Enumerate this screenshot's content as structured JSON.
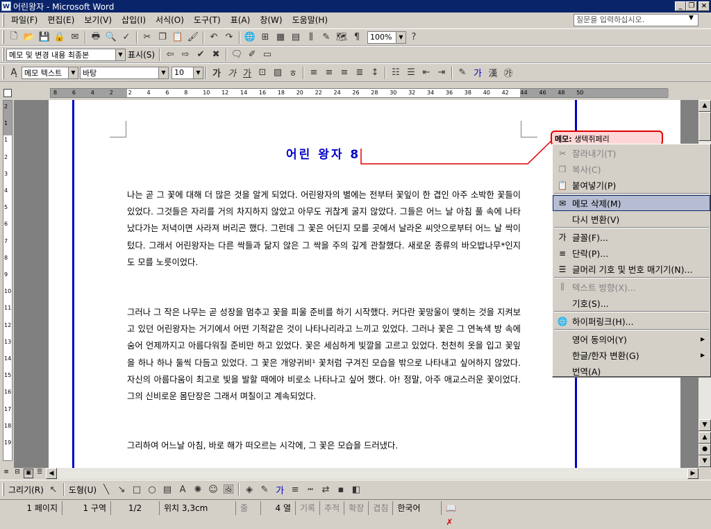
{
  "window": {
    "title": "어린왕자 - Microsoft Word",
    "app_icon": "W"
  },
  "menubar": {
    "items": [
      "파일(F)",
      "편집(E)",
      "보기(V)",
      "삽입(I)",
      "서식(O)",
      "도구(T)",
      "표(A)",
      "창(W)",
      "도움말(H)"
    ],
    "help_placeholder": "질문을 입력하십시오."
  },
  "toolbar": {
    "zoom": "100%"
  },
  "reviewing": {
    "display_mode": "메모 및 변경 내용 최종본",
    "show_label": "표시(S)"
  },
  "formatting": {
    "style": "메모 텍스트",
    "font": "바탕",
    "size": "10"
  },
  "ruler": {
    "h_labels": [
      "8",
      "6",
      "4",
      "2",
      "2",
      "4",
      "6",
      "8",
      "10",
      "12",
      "14",
      "16",
      "18",
      "20",
      "22",
      "24",
      "26",
      "28",
      "30",
      "32",
      "34",
      "36",
      "38",
      "40",
      "42",
      "44",
      "46",
      "48",
      "50"
    ],
    "v_labels": [
      "2",
      "1",
      "1",
      "2",
      "3",
      "4",
      "5",
      "6",
      "7",
      "8",
      "9",
      "10",
      "11",
      "12",
      "13",
      "14",
      "15",
      "16",
      "17",
      "18",
      "19"
    ]
  },
  "document": {
    "title": "어린 왕자 8",
    "paragraphs": [
      "나는 곧 그 꽃에 대해 더 많은 것을 알게 되었다. 어린왕자의 별에는 전부터 꽃잎이 한 겹인 아주 소박한 꽃들이 있었다. 그것들은 자리를 거의 차지하지 않았고 아무도 귀찮게 굴지 않았다. 그들은 어느 날 아침 풀 속에 나타났다가는 저녁이면 사라져 버리곤 했다. 그런데 그 꽃은 어딘지 모를 곳에서 날라온 씨앗으로부터 어느 날 싹이 텄다. 그래서 어린왕자는 다른 싹들과 닮지 않은 그 싹을 주의 깊게 관찰했다. 새로운 종류의 바오밥나무*인지 도 모를 노릇이었다.",
      "그러나 그 작은 나무는 곧 성장을 멈추고 꽃을 피울 준비를 하기 시작했다. 커다란 꽃망울이 맺히는 것을 지켜보고 있던 어린왕자는 거기에서 어떤 기적같은 것이 나타나리라고 느끼고 있었다. 그러나 꽃은 그 연녹색 방 속에 숨어 언제까지고 아름다워질 준비만 하고 있었다. 꽃은 세심하게 빛깔을 고르고 있었다. 천천히 옷을 입고 꽃잎을 하나 하나 둘씩 다듬고 있었다. 그 꽃은 개양귀비¹ 꽃처럼 구겨진 모습을 밖으로 나타내고 싶어하지 않았다. 자신의 아름다움이 최고로 빛을 발할 때에야 비로소 나타나고 싶어 했다. 아! 정말, 아주 애교스러운 꽃이었다. 그의 신비로운 몸단장은 그래서 며칠이고 계속되었다.",
      "그리하여 어느날 아침, 바로 해가 떠오르는 시각에, 그 꽃은 모습을 드러냈다."
    ]
  },
  "comment": {
    "label": "메모:",
    "author": "생텍쥐페리"
  },
  "context_menu": {
    "items": [
      {
        "label": "잘라내기(T)",
        "icon": "scissors-icon",
        "glyph": "✂",
        "disabled": true
      },
      {
        "label": "복사(C)",
        "icon": "copy-icon",
        "glyph": "❐",
        "disabled": true
      },
      {
        "label": "붙여넣기(P)",
        "icon": "paste-icon",
        "glyph": "📋",
        "disabled": false
      },
      {
        "label": "메모 삭제(M)",
        "icon": "delete-comment-icon",
        "glyph": "✉",
        "disabled": false,
        "selected": true
      },
      {
        "label": "다시 변환(V)",
        "icon": "",
        "glyph": "",
        "disabled": false
      },
      {
        "label": "글꼴(F)...",
        "icon": "font-icon",
        "glyph": "가",
        "disabled": false
      },
      {
        "label": "단락(P)...",
        "icon": "paragraph-icon",
        "glyph": "≡",
        "disabled": false
      },
      {
        "label": "글머리 기호 및 번호 매기기(N)...",
        "icon": "bullets-icon",
        "glyph": "☰",
        "disabled": false
      },
      {
        "label": "텍스트 방향(X)...",
        "icon": "text-direction-icon",
        "glyph": "⫼",
        "disabled": true
      },
      {
        "label": "기호(S)...",
        "icon": "",
        "glyph": "",
        "disabled": false
      },
      {
        "label": "하이퍼링크(H)...",
        "icon": "hyperlink-icon",
        "glyph": "🌐",
        "disabled": false
      },
      {
        "label": "영어 동의어(Y)",
        "icon": "",
        "glyph": "",
        "disabled": false,
        "submenu": true
      },
      {
        "label": "한글/한자 변환(G)",
        "icon": "",
        "glyph": "",
        "disabled": false,
        "submenu": true
      },
      {
        "label": "번역(A)",
        "icon": "",
        "glyph": "",
        "disabled": false
      }
    ]
  },
  "drawbar": {
    "draw_label": "그리기(R)",
    "shapes_label": "도형(U)"
  },
  "statusbar": {
    "page": "1 페이지",
    "section": "1 구역",
    "page_of": "1/2",
    "position": "위치 3,3cm",
    "line": "줄",
    "col": "4 열",
    "rec": "기록",
    "trk": "추적",
    "ext": "확장",
    "ovr": "겹침",
    "language": "한국어"
  },
  "colors": {
    "title_bar": "#0a246a",
    "comment_border": "#e00000",
    "comment_fill": "#ffd6d6",
    "margin_line": "#0000c8",
    "menu_highlight": "#b6bdd2"
  }
}
